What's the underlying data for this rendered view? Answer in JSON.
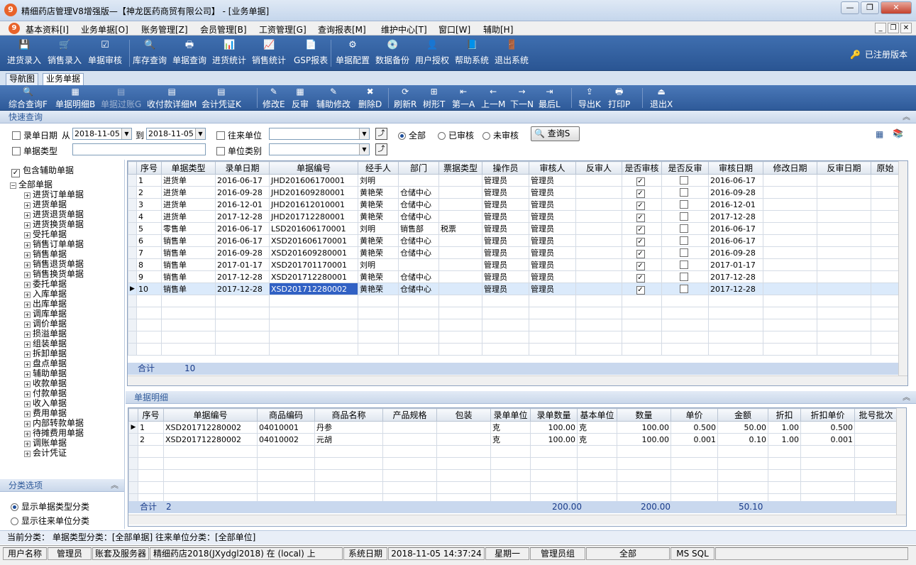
{
  "window": {
    "title": "精细药店管理V8增强版—【神龙医药商贸有限公司】 - [业务单据]",
    "logo_text": "9",
    "btn_minimize": "—",
    "btn_maximize": "❐",
    "btn_close": "✕"
  },
  "menubar": {
    "items": [
      "基本资料[I]",
      "业务单据[O]",
      "账务管理[Z]",
      "会员管理[B]",
      "工资管理[G]",
      "查询报表[M]",
      "维护中心[T]",
      "窗口[W]",
      "辅助[H]"
    ],
    "mdi_min": "_",
    "mdi_restore": "❐",
    "mdi_close": "✕"
  },
  "toolbar1": {
    "items": [
      {
        "label": "进货录入",
        "icon": "💾"
      },
      {
        "label": "销售录入",
        "icon": "🛒"
      },
      {
        "label": "单据审核",
        "icon": "☑"
      },
      {
        "label": "库存查询",
        "icon": "🔍"
      },
      {
        "label": "单据查询",
        "icon": "🖶"
      },
      {
        "label": "进货统计",
        "icon": "📊"
      },
      {
        "label": "销售统计",
        "icon": "📈"
      },
      {
        "label": "GSP报表",
        "icon": "📄"
      },
      {
        "label": "单据配置",
        "icon": "⚙"
      },
      {
        "label": "数据备份",
        "icon": "💿"
      },
      {
        "label": "用户授权",
        "icon": "👤"
      },
      {
        "label": "帮助系统",
        "icon": "📘"
      },
      {
        "label": "退出系统",
        "icon": "🚪"
      }
    ],
    "registered": "已注册版本",
    "registered_icon": "🔑"
  },
  "tabs": [
    "导航图",
    "业务单据"
  ],
  "toolbar2": {
    "items": [
      {
        "label": "综合查询F",
        "icon": "🔍",
        "disabled": false
      },
      {
        "label": "单据明细B",
        "icon": "▦",
        "disabled": false
      },
      {
        "label": "单据过账G",
        "icon": "▤",
        "disabled": true
      },
      {
        "label": "收付款详细M",
        "icon": "▤",
        "disabled": false
      },
      {
        "label": "会计凭证K",
        "icon": "▤",
        "disabled": false
      },
      {
        "label": "修改E",
        "icon": "✎",
        "disabled": false
      },
      {
        "label": "反审",
        "icon": "▦",
        "disabled": false
      },
      {
        "label": "辅助修改",
        "icon": "✎",
        "disabled": false
      },
      {
        "label": "删除D",
        "icon": "✖",
        "disabled": false
      },
      {
        "label": "刷新R",
        "icon": "⟳",
        "disabled": false
      },
      {
        "label": "树形T",
        "icon": "⊞",
        "disabled": false
      },
      {
        "label": "第一A",
        "icon": "⇤",
        "disabled": false
      },
      {
        "label": "上一M",
        "icon": "←",
        "disabled": false
      },
      {
        "label": "下一N",
        "icon": "→",
        "disabled": false
      },
      {
        "label": "最后L",
        "icon": "⇥",
        "disabled": false
      },
      {
        "label": "导出K",
        "icon": "⇪",
        "disabled": false
      },
      {
        "label": "打印P",
        "icon": "🖶",
        "disabled": false
      },
      {
        "label": "退出X",
        "icon": "⏏",
        "disabled": false
      }
    ]
  },
  "quick_query": {
    "header": "快速查询",
    "date_label": "录单日期",
    "from_label": "从",
    "from_date": "2018-11-05",
    "to_label": "到",
    "to_date": "2018-11-05",
    "bill_type_label": "单据类型",
    "partner_label": "往来单位",
    "partner_value": "",
    "unit_category_label": "单位类别",
    "unit_category_value": "",
    "radio_all": "全部",
    "radio_audited": "已审核",
    "radio_unaudited": "未审核",
    "query_button": "查询S"
  },
  "left_pane": {
    "include_aux": "包含辅助单据",
    "tree_root": "全部单据",
    "tree_items": [
      "进货订单单据",
      "进货单据",
      "进货退货单据",
      "进货换货单据",
      "受托单据",
      "销售订单单据",
      "销售单据",
      "销售退货单据",
      "销售换货单据",
      "委托单据",
      "入库单据",
      "出库单据",
      "调库单据",
      "调价单据",
      "损溢单据",
      "组装单据",
      "拆卸单据",
      "盘点单据",
      "辅助单据",
      "收款单据",
      "付款单据",
      "收入单据",
      "费用单据",
      "内部转款单据",
      "待摊费用单据",
      "调账单据",
      "会计凭证"
    ],
    "category_header": "分类选项",
    "opt_bill_type": "显示单据类型分类",
    "opt_partner": "显示往来单位分类"
  },
  "main_grid": {
    "columns": [
      "序号",
      "单据类型",
      "录单日期",
      "单据编号",
      "经手人",
      "部门",
      "票据类型",
      "操作员",
      "审核人",
      "反审人",
      "是否审核",
      "是否反审",
      "审核日期",
      "修改日期",
      "反审日期",
      "原始"
    ],
    "rows": [
      [
        "1",
        "进货单",
        "2016-06-17",
        "JHD201606170001",
        "刘明",
        "",
        "",
        "管理员",
        "管理员",
        "",
        "✓",
        "",
        "2016-06-17",
        "",
        ""
      ],
      [
        "2",
        "进货单",
        "2016-09-28",
        "JHD201609280001",
        "黄艳荣",
        "仓储中心",
        "",
        "管理员",
        "管理员",
        "",
        "✓",
        "",
        "2016-09-28",
        "",
        ""
      ],
      [
        "3",
        "进货单",
        "2016-12-01",
        "JHD201612010001",
        "黄艳荣",
        "仓储中心",
        "",
        "管理员",
        "管理员",
        "",
        "✓",
        "",
        "2016-12-01",
        "",
        ""
      ],
      [
        "4",
        "进货单",
        "2017-12-28",
        "JHD201712280001",
        "黄艳荣",
        "仓储中心",
        "",
        "管理员",
        "管理员",
        "",
        "✓",
        "",
        "2017-12-28",
        "",
        ""
      ],
      [
        "5",
        "零售单",
        "2016-06-17",
        "LSD201606170001",
        "刘明",
        "销售部",
        "税票",
        "管理员",
        "管理员",
        "",
        "✓",
        "",
        "2016-06-17",
        "",
        ""
      ],
      [
        "6",
        "销售单",
        "2016-06-17",
        "XSD201606170001",
        "黄艳荣",
        "仓储中心",
        "",
        "管理员",
        "管理员",
        "",
        "✓",
        "",
        "2016-06-17",
        "",
        ""
      ],
      [
        "7",
        "销售单",
        "2016-09-28",
        "XSD201609280001",
        "黄艳荣",
        "仓储中心",
        "",
        "管理员",
        "管理员",
        "",
        "✓",
        "",
        "2016-09-28",
        "",
        ""
      ],
      [
        "8",
        "销售单",
        "2017-01-17",
        "XSD201701170001",
        "刘明",
        "",
        "",
        "管理员",
        "管理员",
        "",
        "✓",
        "",
        "2017-01-17",
        "",
        ""
      ],
      [
        "9",
        "销售单",
        "2017-12-28",
        "XSD201712280001",
        "黄艳荣",
        "仓储中心",
        "",
        "管理员",
        "管理员",
        "",
        "✓",
        "",
        "2017-12-28",
        "",
        ""
      ],
      [
        "10",
        "销售单",
        "2017-12-28",
        "XSD201712280002",
        "黄艳荣",
        "仓储中心",
        "",
        "管理员",
        "管理员",
        "",
        "✓",
        "",
        "2017-12-28",
        "",
        ""
      ]
    ],
    "total_label": "合计",
    "total_count": "10"
  },
  "detail": {
    "header": "单据明细",
    "columns": [
      "序号",
      "单据编号",
      "商品编码",
      "商品名称",
      "产品规格",
      "包装",
      "录单单位",
      "录单数量",
      "基本单位",
      "数量",
      "单价",
      "金额",
      "折扣",
      "折扣单价",
      "批号批次"
    ],
    "rows": [
      [
        "1",
        "XSD201712280002",
        "04010001",
        "丹参",
        "",
        "",
        "克",
        "100.00",
        "克",
        "100.00",
        "0.500",
        "50.00",
        "1.00",
        "0.500",
        ""
      ],
      [
        "2",
        "XSD201712280002",
        "04010002",
        "元胡",
        "",
        "",
        "克",
        "100.00",
        "克",
        "100.00",
        "0.001",
        "0.10",
        "1.00",
        "0.001",
        ""
      ]
    ],
    "total_label": "合计",
    "total_count": "2",
    "total_qty1": "200.00",
    "total_qty2": "200.00",
    "total_amount": "50.10"
  },
  "status1": "当前分类：  单据类型分类：[全部单据] 往来单位分类：[全部单位]",
  "status2": {
    "user_label": "用户名称",
    "user": "管理员",
    "account_label": "账套及服务器",
    "account": "精细药店2018(JXydgl2018) 在 (local) 上",
    "date_label": "系统日期",
    "datetime": "2018-11-05  14:37:24",
    "weekday": "星期一",
    "group": "管理员组",
    "scope": "全部",
    "db": "MS SQL"
  }
}
